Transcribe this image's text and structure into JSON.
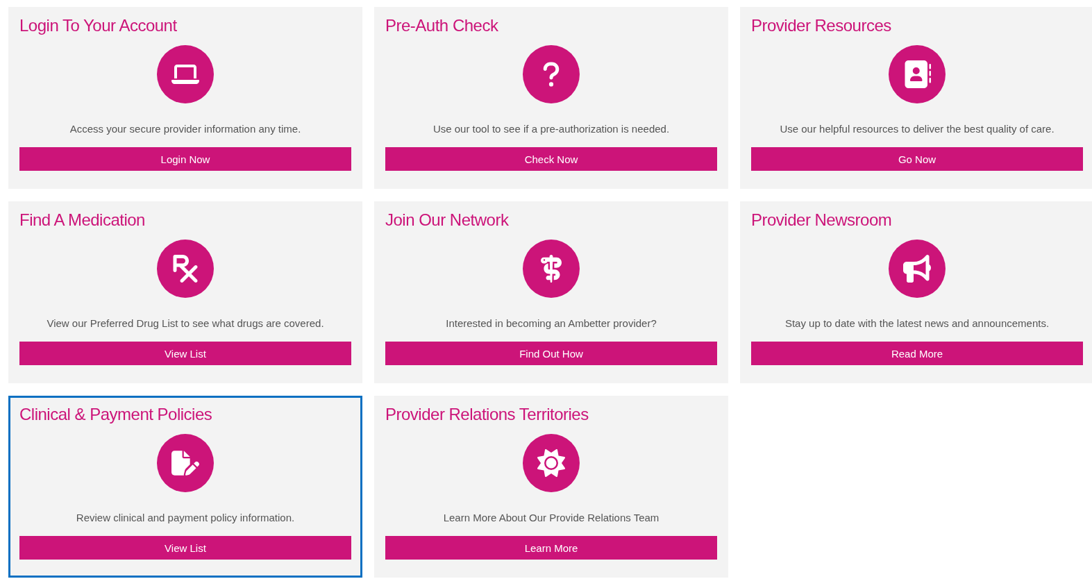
{
  "cards": [
    {
      "title": "Login To Your Account",
      "description": "Access your secure provider information any time.",
      "button": "Login Now",
      "highlighted": false
    },
    {
      "title": "Pre-Auth Check",
      "description": "Use our tool to see if a pre-authorization is needed.",
      "button": "Check Now",
      "highlighted": false
    },
    {
      "title": "Provider Resources",
      "description": "Use our helpful resources to deliver the best quality of care.",
      "button": "Go Now",
      "highlighted": false
    },
    {
      "title": "Find A Medication",
      "description": "View our Preferred Drug List to see what drugs are covered.",
      "button": "View List",
      "highlighted": false
    },
    {
      "title": "Join Our Network",
      "description": "Interested in becoming an Ambetter provider?",
      "button": "Find Out How",
      "highlighted": false
    },
    {
      "title": "Provider Newsroom",
      "description": "Stay up to date with the latest news and announcements.",
      "button": "Read More",
      "highlighted": false
    },
    {
      "title": "Clinical & Payment Policies",
      "description": "Review clinical and payment policy information.",
      "button": "View List",
      "highlighted": true
    },
    {
      "title": "Provider Relations Territories",
      "description": "Learn More About Our Provide Relations Team",
      "button": "Learn More",
      "highlighted": false
    }
  ]
}
